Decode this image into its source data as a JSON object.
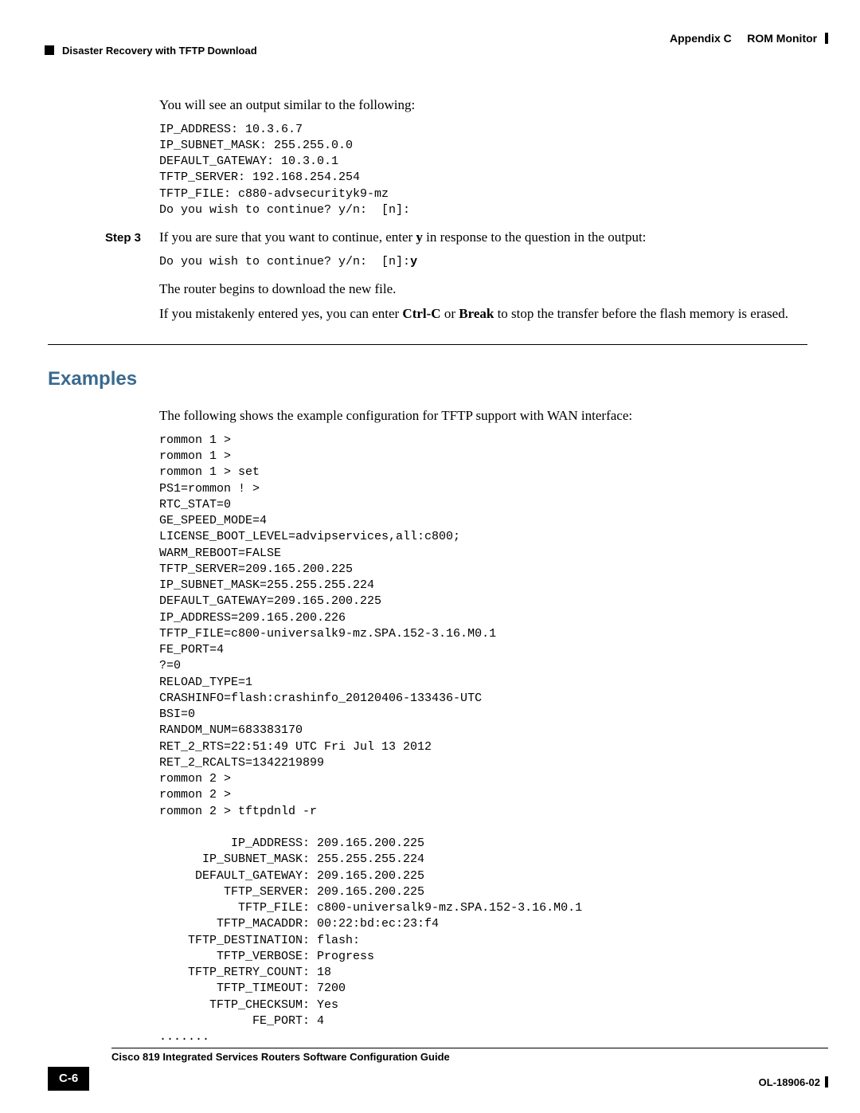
{
  "header": {
    "appendix_label": "Appendix C",
    "appendix_title": "ROM Monitor",
    "section_title": "Disaster Recovery with TFTP Download"
  },
  "intro_para": "You will see an output similar to the following:",
  "code1": "IP_ADDRESS: 10.3.6.7\nIP_SUBNET_MASK: 255.255.0.0\nDEFAULT_GATEWAY: 10.3.0.1\nTFTP_SERVER: 192.168.254.254\nTFTP_FILE: c880-advsecurityk9-mz\nDo you wish to continue? y/n:  [n]:",
  "step3": {
    "label": "Step 3",
    "text_pre": "If you are sure that you want to continue, enter ",
    "text_bold": "y",
    "text_post": " in response to the question in the output:"
  },
  "code2_pre": "Do you wish to continue? y/n:  [n]:",
  "code2_bold": "y",
  "after_step_para1": "The router begins to download the new file.",
  "after_step_para2_pre": "If you mistakenly entered yes, you can enter ",
  "after_step_para2_b1": "Ctrl-C",
  "after_step_para2_mid": " or ",
  "after_step_para2_b2": "Break",
  "after_step_para2_post": " to stop the transfer before the flash memory is erased.",
  "examples_heading": "Examples",
  "examples_intro": "The following shows the example configuration for TFTP support with WAN interface:",
  "code3": "rommon 1 >\nrommon 1 >\nrommon 1 > set\nPS1=rommon ! >\nRTC_STAT=0\nGE_SPEED_MODE=4\nLICENSE_BOOT_LEVEL=advipservices,all:c800;\nWARM_REBOOT=FALSE\nTFTP_SERVER=209.165.200.225\nIP_SUBNET_MASK=255.255.255.224\nDEFAULT_GATEWAY=209.165.200.225\nIP_ADDRESS=209.165.200.226\nTFTP_FILE=c800-universalk9-mz.SPA.152-3.16.M0.1\nFE_PORT=4\n?=0\nRELOAD_TYPE=1\nCRASHINFO=flash:crashinfo_20120406-133436-UTC\nBSI=0\nRANDOM_NUM=683383170\nRET_2_RTS=22:51:49 UTC Fri Jul 13 2012\nRET_2_RCALTS=1342219899\nrommon 2 >\nrommon 2 >\nrommon 2 > tftpdnld -r\n\n          IP_ADDRESS: 209.165.200.225\n      IP_SUBNET_MASK: 255.255.255.224\n     DEFAULT_GATEWAY: 209.165.200.225\n         TFTP_SERVER: 209.165.200.225\n           TFTP_FILE: c800-universalk9-mz.SPA.152-3.16.M0.1\n        TFTP_MACADDR: 00:22:bd:ec:23:f4\n    TFTP_DESTINATION: flash:\n        TFTP_VERBOSE: Progress\n    TFTP_RETRY_COUNT: 18\n        TFTP_TIMEOUT: 7200\n       TFTP_CHECKSUM: Yes\n             FE_PORT: 4\n.......",
  "footer": {
    "guide_title": "Cisco 819 Integrated Services Routers Software Configuration Guide",
    "page_number": "C-6",
    "doc_id": "OL-18906-02"
  }
}
